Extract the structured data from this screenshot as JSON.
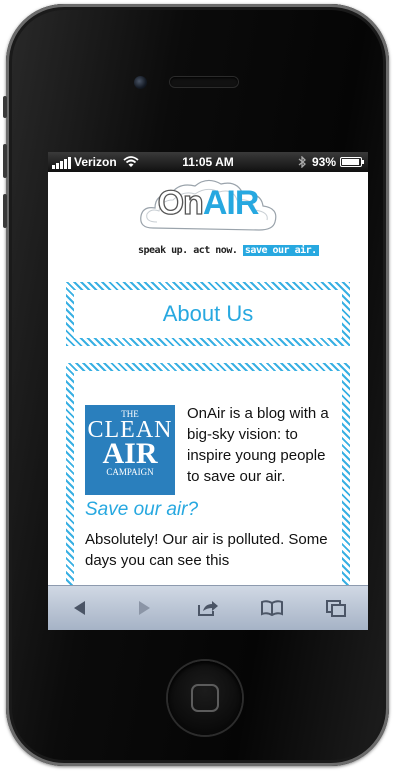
{
  "status_bar": {
    "carrier": "Verizon",
    "time": "11:05 AM",
    "battery": "93%"
  },
  "header": {
    "logo_on": "On",
    "logo_air": "AIR",
    "tagline_prefix": "speak up. act now.",
    "tagline_highlight": "save our air."
  },
  "about": {
    "title": "About Us"
  },
  "article": {
    "badge_line1": "THE",
    "badge_line2": "CLEAN",
    "badge_line3": "AIR",
    "badge_line4": "CAMPAIGN",
    "intro": "OnAir is a blog with a big-sky vision: to inspire young people to save our air.",
    "subheading": "Save our air?",
    "body": "Absolutely! Our air is polluted. Some days you can see this"
  },
  "toolbar": {
    "items": [
      "back-icon",
      "forward-icon",
      "share-icon",
      "bookmarks-icon",
      "tabs-icon"
    ]
  }
}
